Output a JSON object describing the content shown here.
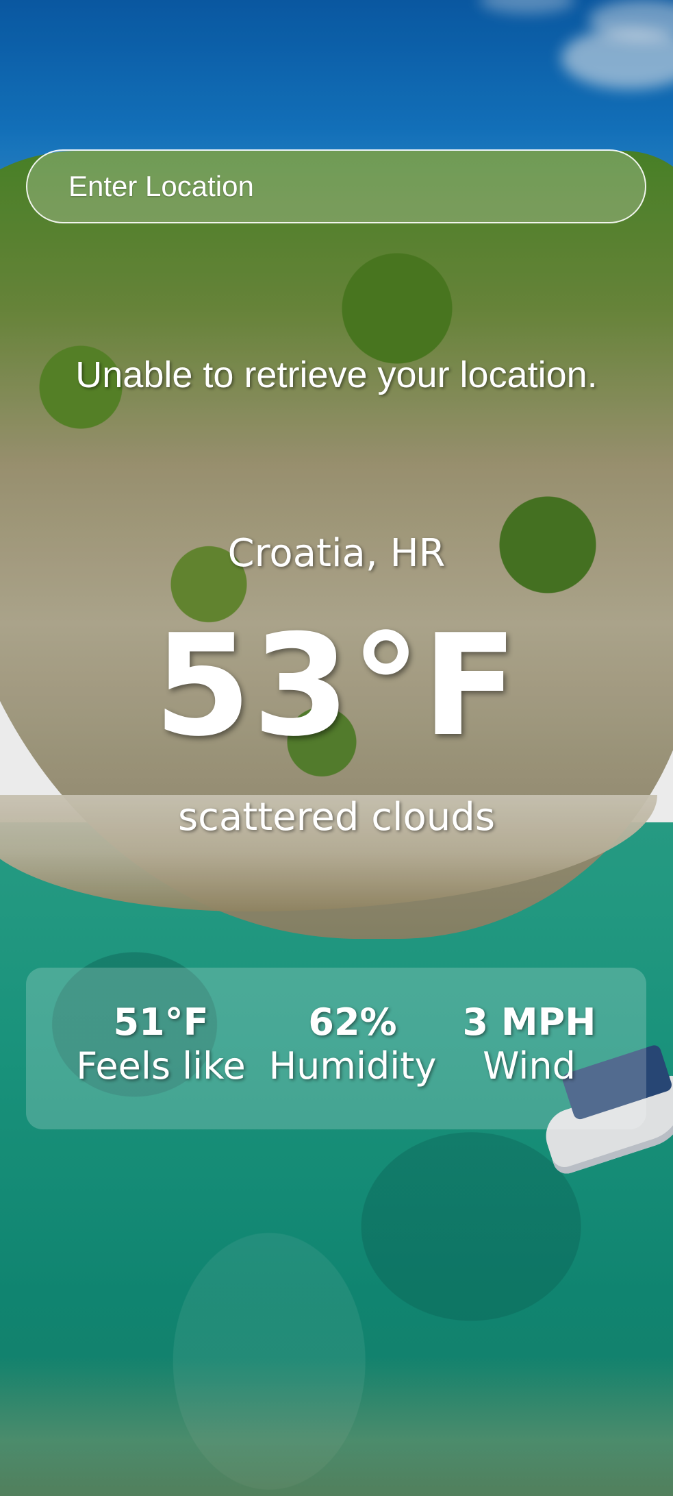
{
  "search": {
    "placeholder": "Enter Location",
    "value": ""
  },
  "status_message": "Unable to retrieve your location.",
  "weather": {
    "location": "Croatia, HR",
    "temperature": "53°F",
    "description": "scattered clouds"
  },
  "details": [
    {
      "value": "51°F",
      "label": "Feels like"
    },
    {
      "value": "62%",
      "label": "Humidity"
    },
    {
      "value": "3 MPH",
      "label": "Wind"
    }
  ],
  "colors": {
    "text": "#ffffff",
    "sky": "#1479c8",
    "sea": "#1c9f86"
  }
}
